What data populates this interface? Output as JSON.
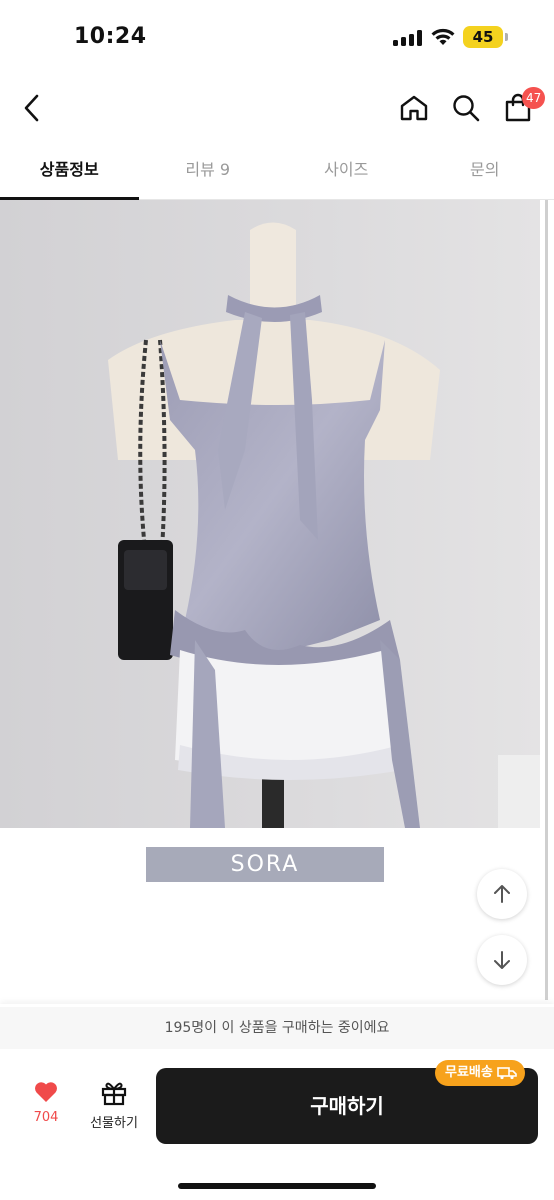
{
  "status_bar": {
    "time": "10:24",
    "battery": "45"
  },
  "header": {
    "cart_count": "47"
  },
  "tabs": [
    {
      "label": "상품정보",
      "active": true
    },
    {
      "label": "리뷰 9",
      "active": false
    },
    {
      "label": "사이즈",
      "active": false
    },
    {
      "label": "문의",
      "active": false
    }
  ],
  "product": {
    "brand_banner": "SORA"
  },
  "bottom": {
    "purchase_notice": "195명이 이 상품을 구매하는 중이에요",
    "like_count": "704",
    "gift_label": "선물하기",
    "buy_label": "구매하기",
    "free_shipping": "무료배송"
  },
  "colors": {
    "accent_heart": "#f04a4a",
    "badge": "#f5524f",
    "free_shipping": "#f7a21c",
    "buy_button": "#1b1b1b"
  }
}
